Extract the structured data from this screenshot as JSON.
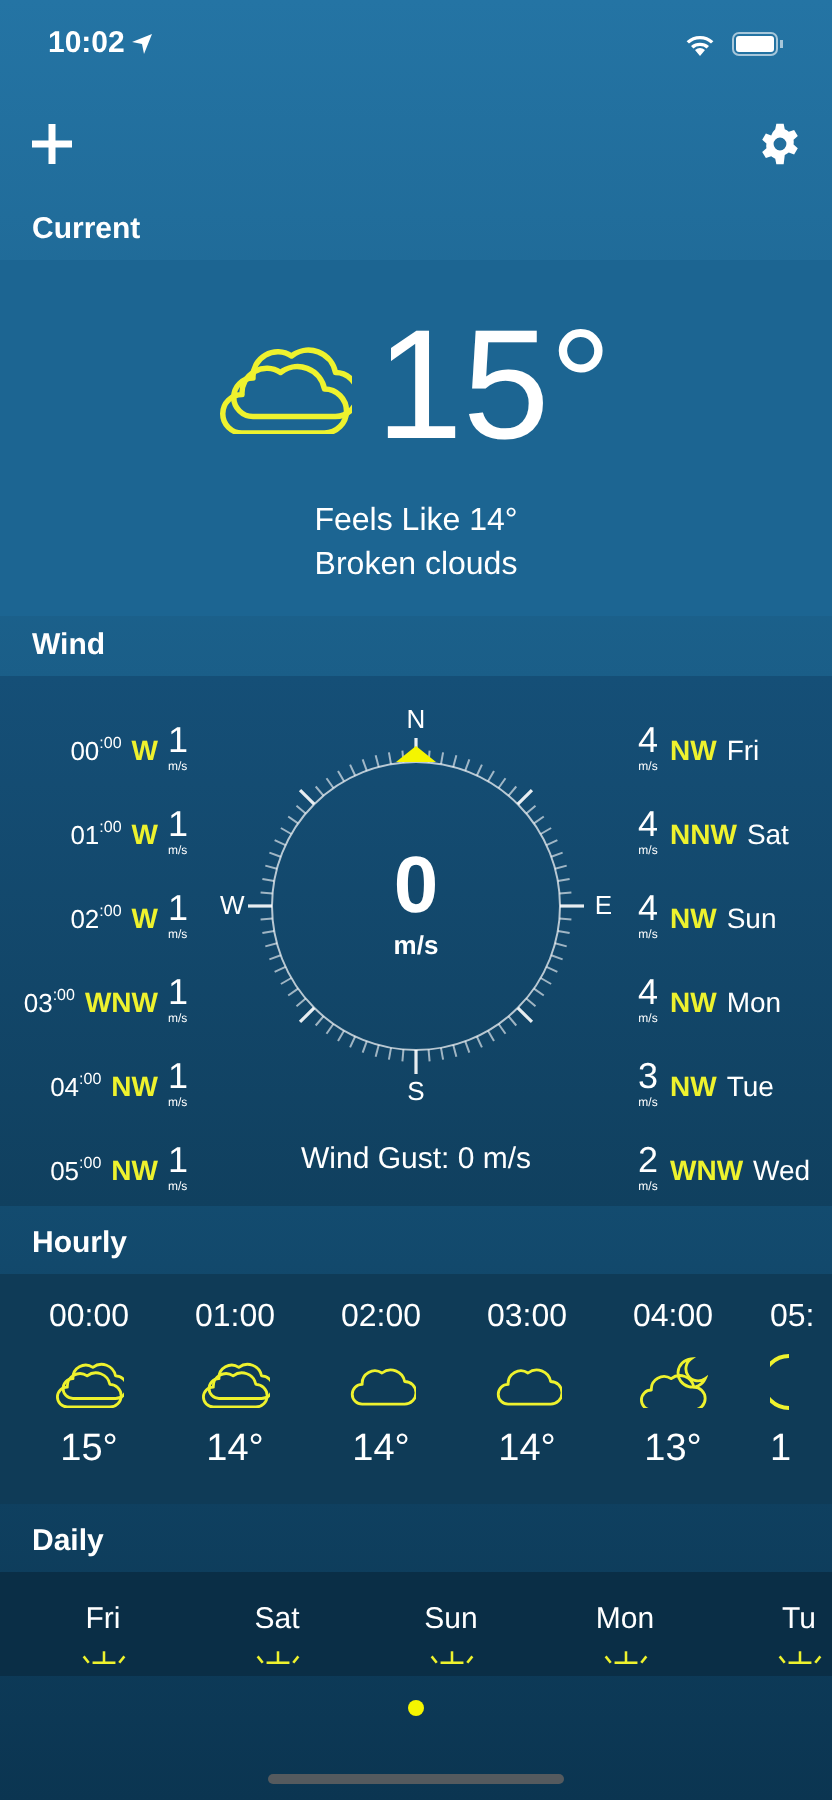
{
  "status_bar": {
    "time": "10:02"
  },
  "current": {
    "title": "Current",
    "kind": "broken-clouds",
    "temperature": "15°",
    "feels_like": "Feels Like 14°",
    "description": "Broken clouds"
  },
  "wind": {
    "title": "Wind",
    "hourly": [
      {
        "hour": "00",
        "minutes": ":00",
        "direction": "W",
        "speed": "1",
        "unit": "m/s"
      },
      {
        "hour": "01",
        "minutes": ":00",
        "direction": "W",
        "speed": "1",
        "unit": "m/s"
      },
      {
        "hour": "02",
        "minutes": ":00",
        "direction": "W",
        "speed": "1",
        "unit": "m/s"
      },
      {
        "hour": "03",
        "minutes": ":00",
        "direction": "WNW",
        "speed": "1",
        "unit": "m/s"
      },
      {
        "hour": "04",
        "minutes": ":00",
        "direction": "NW",
        "speed": "1",
        "unit": "m/s"
      },
      {
        "hour": "05",
        "minutes": ":00",
        "direction": "NW",
        "speed": "1",
        "unit": "m/s"
      }
    ],
    "daily": [
      {
        "speed": "4",
        "unit": "m/s",
        "direction": "NW",
        "day": "Fri"
      },
      {
        "speed": "4",
        "unit": "m/s",
        "direction": "NNW",
        "day": "Sat"
      },
      {
        "speed": "4",
        "unit": "m/s",
        "direction": "NW",
        "day": "Sun"
      },
      {
        "speed": "4",
        "unit": "m/s",
        "direction": "NW",
        "day": "Mon"
      },
      {
        "speed": "3",
        "unit": "m/s",
        "direction": "NW",
        "day": "Tue"
      },
      {
        "speed": "2",
        "unit": "m/s",
        "direction": "WNW",
        "day": "Wed"
      }
    ],
    "compass": {
      "north": "N",
      "east": "E",
      "south": "S",
      "west": "W",
      "speed": "0",
      "unit": "m/s"
    },
    "gust": "Wind Gust: 0 m/s"
  },
  "hourly": {
    "title": "Hourly",
    "items": [
      {
        "time": "00:00",
        "kind": "broken-clouds",
        "temperature": "15°"
      },
      {
        "time": "01:00",
        "kind": "broken-clouds",
        "temperature": "14°"
      },
      {
        "time": "02:00",
        "kind": "cloud",
        "temperature": "14°"
      },
      {
        "time": "03:00",
        "kind": "cloud",
        "temperature": "14°"
      },
      {
        "time": "04:00",
        "kind": "moon-cloud",
        "temperature": "13°"
      },
      {
        "time": "05:",
        "kind": "moon",
        "temperature": "1"
      }
    ]
  },
  "daily": {
    "title": "Daily",
    "items": [
      {
        "day": "Fri",
        "kind": "sun"
      },
      {
        "day": "Sat",
        "kind": "sun"
      },
      {
        "day": "Sun",
        "kind": "sun"
      },
      {
        "day": "Mon",
        "kind": "sun"
      },
      {
        "day": "Tu",
        "kind": "sun"
      }
    ]
  },
  "pages": [
    {
      "selected": true
    }
  ]
}
